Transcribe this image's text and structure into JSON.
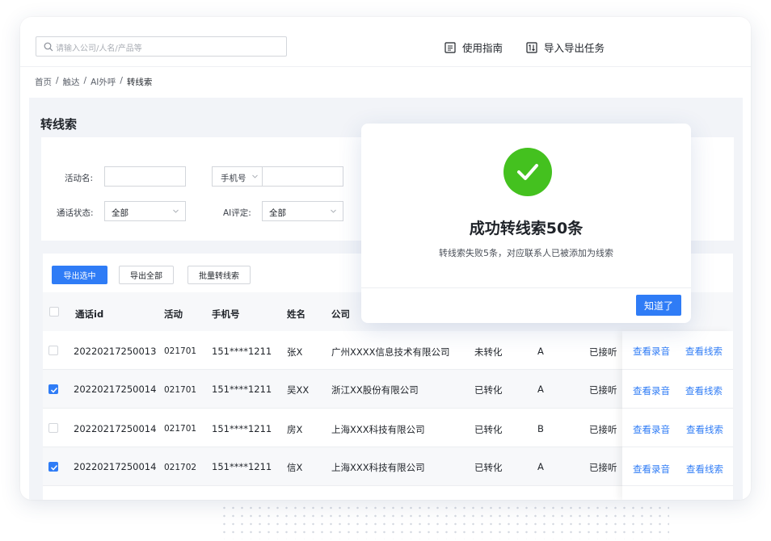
{
  "topbar": {
    "search_placeholder": "请输入公司/人名/产品等",
    "guide_label": "使用指南",
    "io_label": "导入导出任务"
  },
  "breadcrumb": [
    "首页",
    "/",
    "触达",
    "/",
    "AI外呼",
    "/",
    "转线索"
  ],
  "page": {
    "title": "转线索"
  },
  "filters": {
    "activity_label": "活动名:",
    "phone_select": "手机号",
    "call_status_label": "通话状态:",
    "call_status_value": "全部",
    "ai_rating_label": "AI评定:",
    "ai_rating_value": "全部"
  },
  "toolbar": {
    "export_selected": "导出选中",
    "export_all": "导出全部",
    "batch_convert": "批量转线索"
  },
  "table": {
    "headers": [
      "通话id",
      "活动",
      "手机号",
      "姓名",
      "公司"
    ],
    "rows": [
      {
        "checked": false,
        "id": "20220217250013",
        "activity": "021701",
        "phone": "151****1211",
        "name": "张X",
        "company": "广州XXXX信息技术有限公司",
        "convert": "未转化",
        "rating": "A",
        "status": "已接听"
      },
      {
        "checked": true,
        "id": "20220217250014",
        "activity": "021701",
        "phone": "151****1211",
        "name": "吴XX",
        "company": "浙江XX股份有限公司",
        "convert": "已转化",
        "rating": "A",
        "status": "已接听"
      },
      {
        "checked": false,
        "id": "20220217250014",
        "activity": "021701",
        "phone": "151****1211",
        "name": "房X",
        "company": "上海XXX科技有限公司",
        "convert": "已转化",
        "rating": "B",
        "status": "已接听"
      },
      {
        "checked": true,
        "id": "20220217250014",
        "activity": "021702",
        "phone": "151****1211",
        "name": "信X",
        "company": "上海XXX科技有限公司",
        "convert": "已转化",
        "rating": "A",
        "status": "已接听"
      }
    ],
    "action_recording": "查看录音",
    "action_lead": "查看线索"
  },
  "modal": {
    "title": "成功转线索50条",
    "subtitle": "转线索失败5条，对应联系人已被添加为线索",
    "button": "知道了"
  },
  "colors": {
    "primary": "#2f7cf6",
    "success": "#44c11f"
  }
}
